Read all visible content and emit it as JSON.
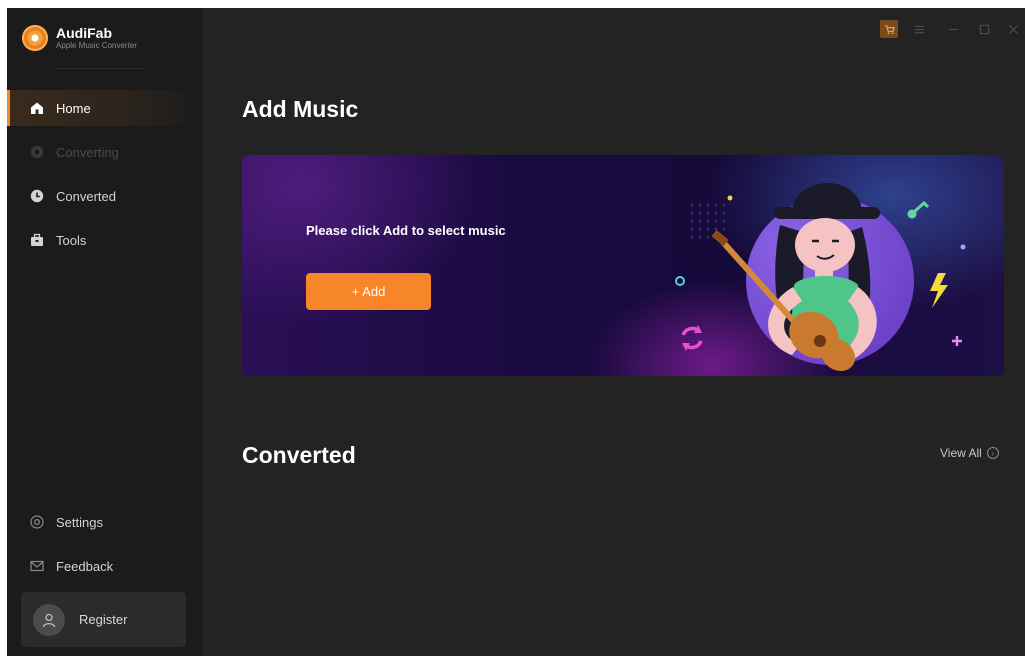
{
  "app": {
    "name": "AudiFab",
    "subtitle": "Apple Music Converter"
  },
  "sidebar": {
    "items": [
      {
        "label": "Home",
        "icon": "home-icon",
        "active": true
      },
      {
        "label": "Converting",
        "icon": "converting-icon",
        "disabled": true
      },
      {
        "label": "Converted",
        "icon": "clock-icon"
      },
      {
        "label": "Tools",
        "icon": "toolbox-icon"
      }
    ],
    "settings_label": "Settings",
    "feedback_label": "Feedback",
    "register_label": "Register"
  },
  "titlebar": {
    "icons": [
      "cart-icon",
      "menu-icon",
      "minimize-icon",
      "maximize-icon",
      "close-icon"
    ]
  },
  "main": {
    "add_music_title": "Add Music",
    "banner_prompt": "Please click Add to select music",
    "add_button_label": "+ Add",
    "converted_title": "Converted",
    "view_all_label": "View All"
  },
  "colors": {
    "accent": "#f7862a",
    "sidebar_bg": "#1b1b1b",
    "main_bg": "#232323"
  }
}
